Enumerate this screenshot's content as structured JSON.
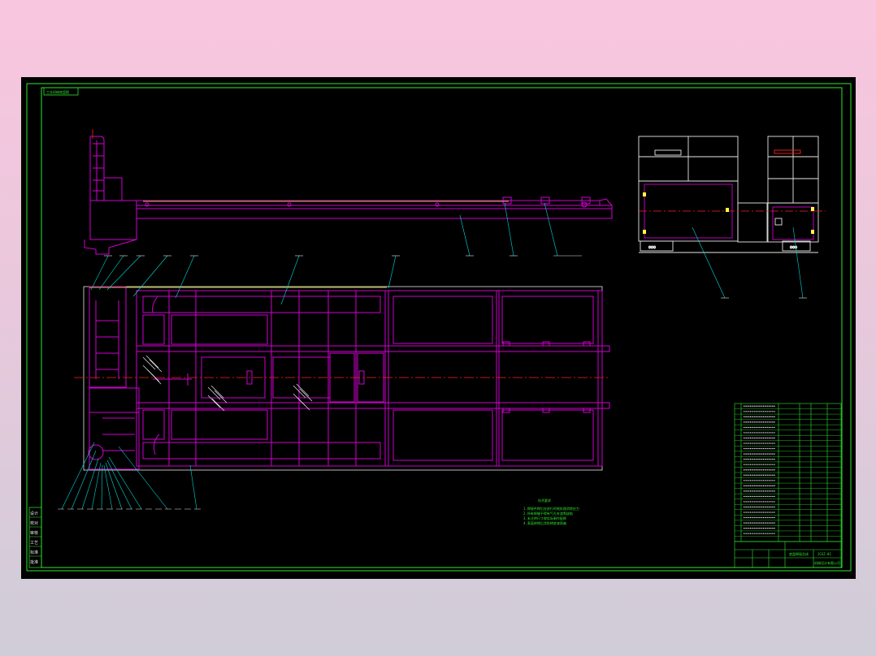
{
  "drawing": {
    "title_tag": "工业机械底盘图",
    "section_note_title": "技术要求",
    "notes": [
      "1.焊接件焊后应进行时效处理消除应力",
      "2.所有焊缝不得有气孔夹渣等缺陷",
      "3.未注明尺寸按实际制作配焊",
      "4.表面除锈后涂防锈底漆两遍"
    ],
    "title_block": {
      "drawing_name": "底盘焊接总成",
      "drawing_no": "JCGZ-01",
      "company": "机械设计有限公司"
    },
    "side_labels": [
      "设计",
      "校对",
      "审核",
      "工艺",
      "标准",
      "批准"
    ],
    "colors": {
      "frame": "#d000d0",
      "border": "#2ee82e",
      "leader": "#00d8d8",
      "center": "#ff2020",
      "accent": "#ffff40"
    }
  }
}
